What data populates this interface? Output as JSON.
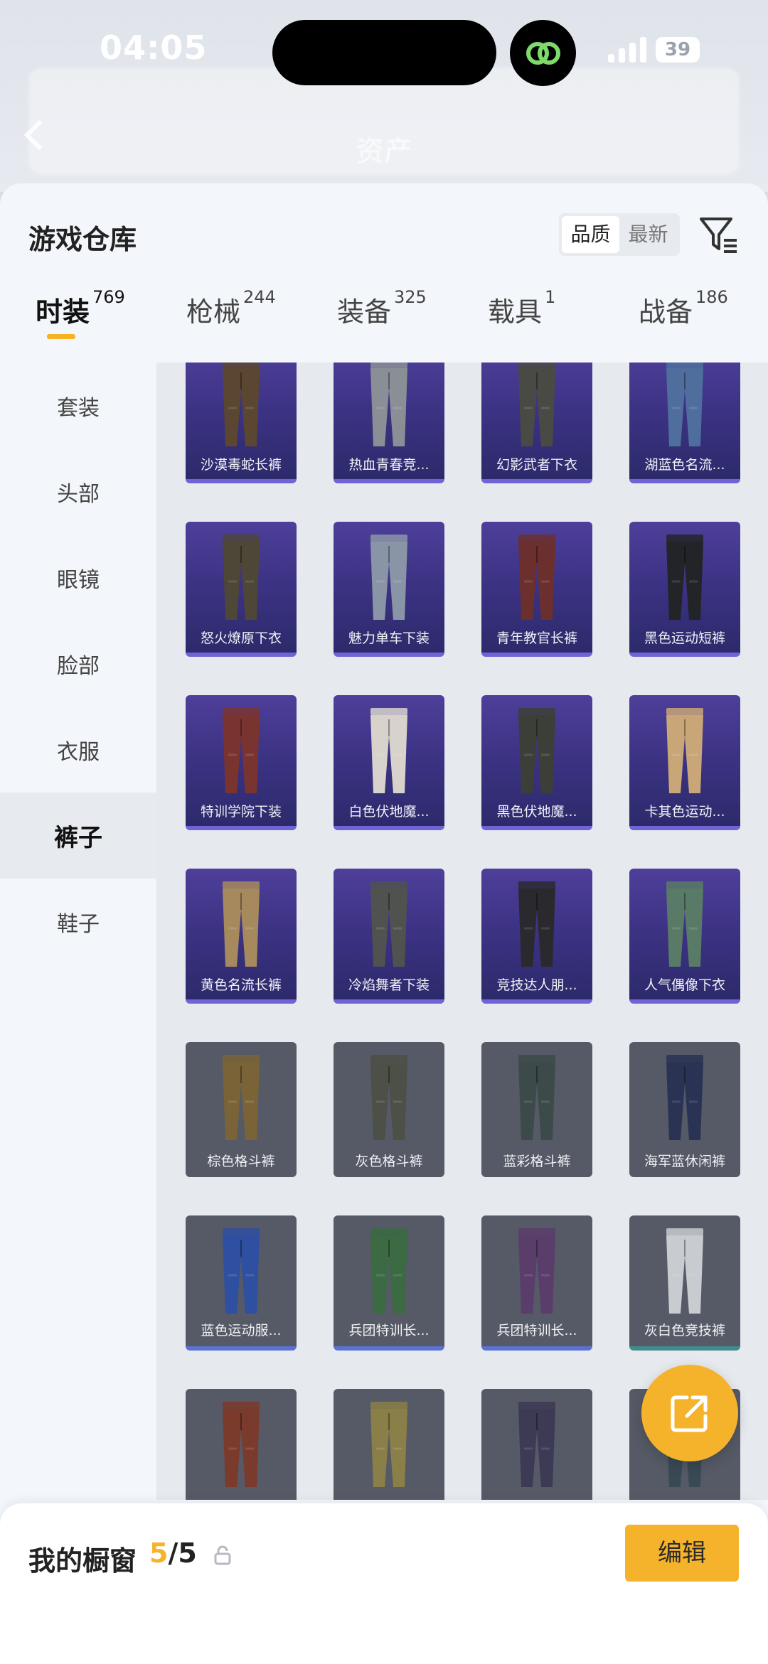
{
  "status_bar": {
    "time": "04:05",
    "battery": "39"
  },
  "header": {
    "title": "资产"
  },
  "sheet": {
    "title": "游戏仓库",
    "sort": {
      "options": [
        "品质",
        "最新"
      ],
      "active": "品质"
    }
  },
  "categories": [
    {
      "label": "时装",
      "count": "769",
      "active": true
    },
    {
      "label": "枪械",
      "count": "244"
    },
    {
      "label": "装备",
      "count": "325"
    },
    {
      "label": "载具",
      "count": "1"
    },
    {
      "label": "战备",
      "count": "186"
    }
  ],
  "sidebar": {
    "items": [
      {
        "label": "套装"
      },
      {
        "label": "头部"
      },
      {
        "label": "眼镜"
      },
      {
        "label": "脸部"
      },
      {
        "label": "衣服"
      },
      {
        "label": "裤子",
        "active": true
      },
      {
        "label": "鞋子"
      }
    ]
  },
  "items": [
    {
      "name": "沙漠毒蛇长裤",
      "rarity": "epic",
      "color": "#5b4632"
    },
    {
      "name": "热血青春竞...",
      "rarity": "epic",
      "color": "#8a8f96"
    },
    {
      "name": "幻影武者下衣",
      "rarity": "epic",
      "color": "#4a4a45"
    },
    {
      "name": "湖蓝色名流...",
      "rarity": "epic",
      "color": "#4f6e9e"
    },
    {
      "name": "怒火燎原下衣",
      "rarity": "epic",
      "color": "#4e4636"
    },
    {
      "name": "魅力单车下装",
      "rarity": "epic",
      "color": "#8995a6"
    },
    {
      "name": "青年教官长裤",
      "rarity": "epic",
      "color": "#6b2f2d"
    },
    {
      "name": "黑色运动短裤",
      "rarity": "epic",
      "color": "#222427"
    },
    {
      "name": "特训学院下装",
      "rarity": "epic",
      "color": "#7a3430"
    },
    {
      "name": "白色伏地魔...",
      "rarity": "epic",
      "color": "#d7d3cc"
    },
    {
      "name": "黑色伏地魔...",
      "rarity": "epic",
      "color": "#3c3f38"
    },
    {
      "name": "卡其色运动...",
      "rarity": "epic",
      "color": "#c9a677"
    },
    {
      "name": "黄色名流长裤",
      "rarity": "epic",
      "color": "#a68a5d"
    },
    {
      "name": "冷焰舞者下装",
      "rarity": "epic",
      "color": "#50524f"
    },
    {
      "name": "竞技达人朋...",
      "rarity": "epic",
      "color": "#2a2a2e"
    },
    {
      "name": "人气偶像下衣",
      "rarity": "epic",
      "color": "#597a66"
    },
    {
      "name": "棕色格斗裤",
      "rarity": "common",
      "color": "#7a6437"
    },
    {
      "name": "灰色格斗裤",
      "rarity": "common",
      "color": "#4d5046"
    },
    {
      "name": "蓝彩格斗裤",
      "rarity": "common",
      "color": "#3d4a4a"
    },
    {
      "name": "海军蓝休闲裤",
      "rarity": "common",
      "color": "#2b3354"
    },
    {
      "name": "蓝色运动服...",
      "rarity": "common",
      "color": "#2f4fa0",
      "border": "blue"
    },
    {
      "name": "兵团特训长...",
      "rarity": "common",
      "color": "#3b6a43",
      "border": "blue"
    },
    {
      "name": "兵团特训长...",
      "rarity": "common",
      "color": "#5a3d6b",
      "border": "blue"
    },
    {
      "name": "灰白色竞技裤",
      "rarity": "common",
      "color": "#c8cbcf",
      "border": "teal"
    },
    {
      "name": "",
      "rarity": "common",
      "color": "#7a3a2c"
    },
    {
      "name": "",
      "rarity": "common",
      "color": "#8a7f48"
    },
    {
      "name": "",
      "rarity": "common",
      "color": "#3d3a55"
    },
    {
      "name": "",
      "rarity": "common",
      "color": "#3a4a55"
    }
  ],
  "footer": {
    "title": "我的橱窗",
    "count_current": "5",
    "count_total": "/5",
    "edit_label": "编辑"
  },
  "colors": {
    "accent": "#f5b32b",
    "epic": "#3d3385",
    "common": "#555a66"
  }
}
